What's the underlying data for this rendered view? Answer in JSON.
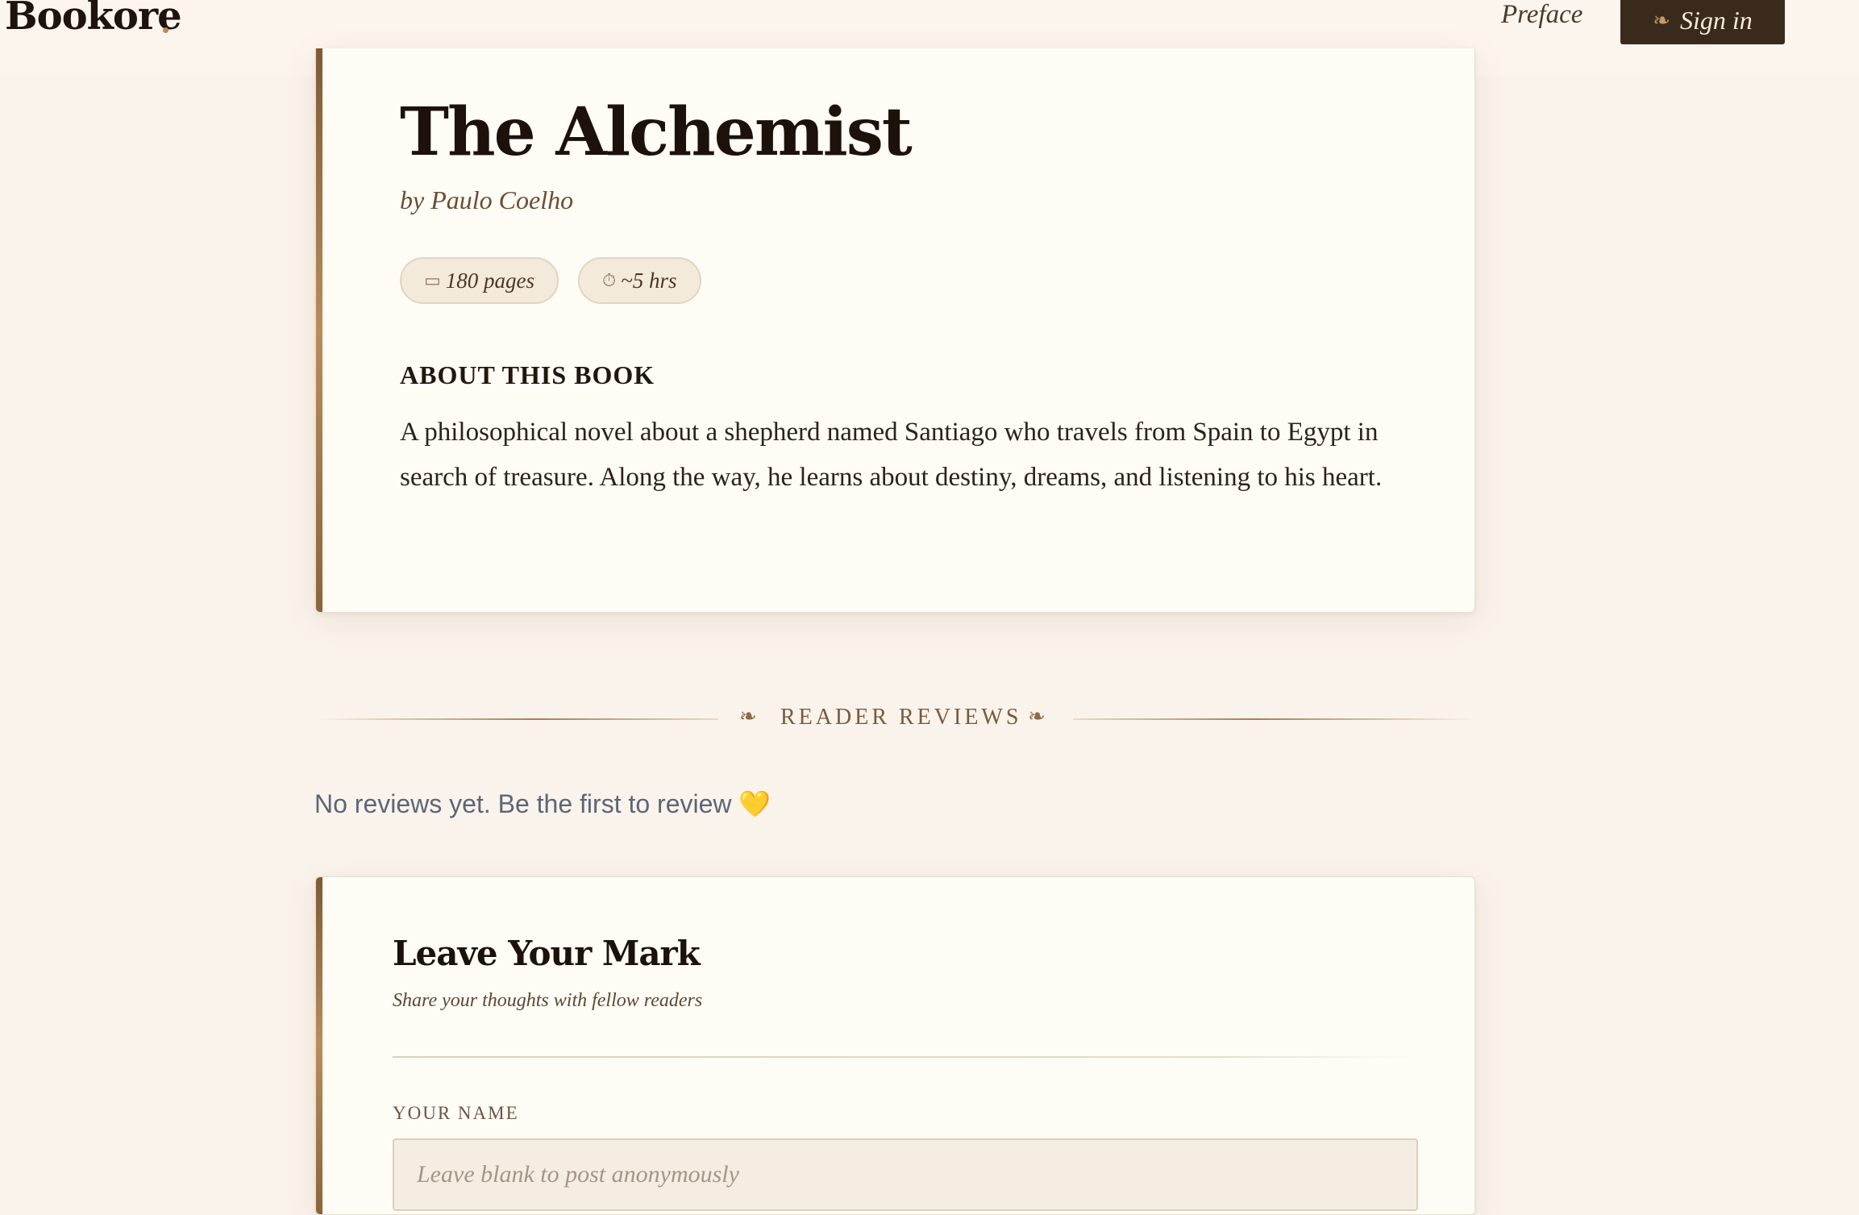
{
  "header": {
    "logo": "Bookore",
    "nav_link": "Preface",
    "signin_icon": "fleuron-icon",
    "signin_label": "Sign in"
  },
  "book": {
    "title": "The Alchemist",
    "author": "by Paulo Coelho",
    "pages_icon": "page-icon",
    "pages": "180 pages",
    "hours_icon": "stopwatch-icon",
    "hours": "~5 hrs",
    "about_heading": "ABOUT THIS BOOK",
    "about_text": "A philosophical novel about a shepherd named Santiago who travels from Spain to Egypt in search of treasure. Along the way, he learns about destiny, dreams, and listening to his heart."
  },
  "reviews": {
    "section_label": "READER REVIEWS",
    "empty_text": "No reviews yet. Be the first to review",
    "empty_emoji": "💛"
  },
  "form": {
    "title": "Leave Your Mark",
    "subtitle": "Share your thoughts with fellow readers",
    "name_label": "YOUR NAME",
    "name_placeholder": "Leave blank to post anonymously",
    "name_value": ""
  },
  "colors": {
    "background": "#faf3ec",
    "card": "#fffcf6",
    "accent_bar": "#8a643c",
    "button_bg": "#3a2a1c",
    "heart": "#e6b82e"
  }
}
